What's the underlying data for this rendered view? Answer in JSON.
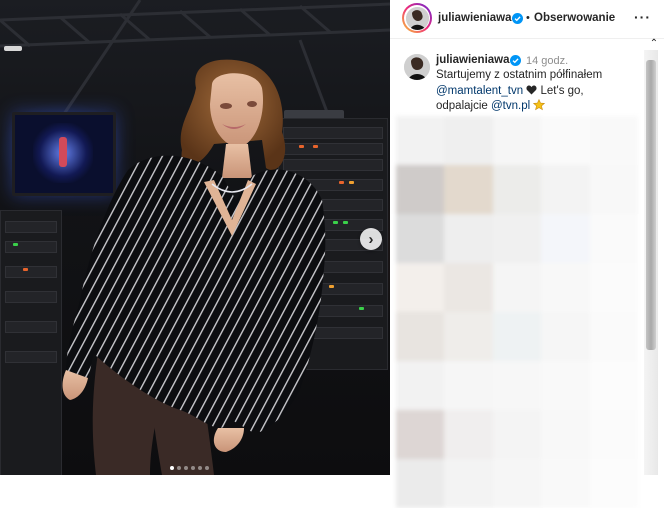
{
  "header": {
    "username": "juliawieniawa",
    "separator": "•",
    "follow_label": "Obserwowanie",
    "more_label": "···"
  },
  "caption": {
    "username": "juliawieniawa",
    "time": "14 godz.",
    "text_line1": "Startujemy z ostatnim półfinałem",
    "mention1": "@mamtalent_tvn",
    "text_after_mention1": " Let's go,",
    "text_line3": "odpalajcie ",
    "mention2": "@tvn.pl"
  },
  "media": {
    "next_icon": "chevron-right-icon",
    "carousel_count": 6,
    "carousel_active": 1
  },
  "colors": {
    "accent_link": "#00376b",
    "verified_blue": "#0095f6",
    "text": "#262626",
    "muted": "#8e8e8e"
  }
}
